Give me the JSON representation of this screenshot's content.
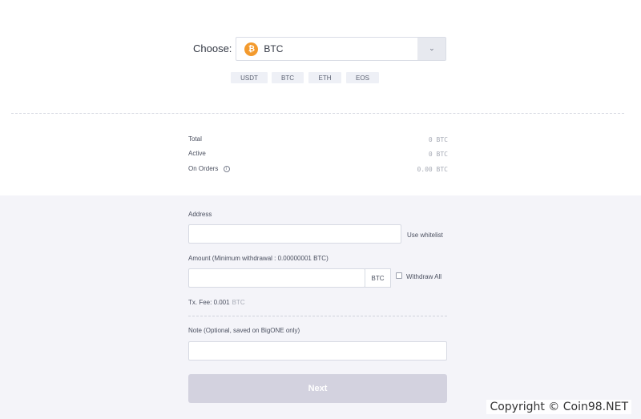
{
  "chooser": {
    "label": "Choose:",
    "selected": "BTC",
    "coin_icon_glyph": "₿",
    "arrow_glyph": "⌄"
  },
  "quick_coins": [
    "USDT",
    "BTC",
    "ETH",
    "EOS"
  ],
  "balance": {
    "total_label": "Total",
    "total_value": "0  BTC",
    "active_label": "Active",
    "active_value": "0  BTC",
    "orders_label": "On Orders",
    "orders_value": "0.00  BTC",
    "info_glyph": "i"
  },
  "form": {
    "address_label": "Address",
    "address_value": "",
    "use_whitelist": "Use whitelist",
    "amount_label": "Amount (Minimum withdrawal : 0.00000001 BTC)",
    "amount_value": "",
    "amount_unit": "BTC",
    "withdraw_all": "Withdraw All",
    "fee_label": "Tx. Fee: 0.001",
    "fee_unit": "BTC",
    "note_label": "Note (Optional, saved on BigONE only)",
    "note_value": "",
    "next_button": "Next"
  },
  "watermark": "Copyright © Coin98.NET",
  "colors": {
    "btc_orange": "#f39a2d",
    "form_bg": "#f4f4f9",
    "next_disabled": "#d3d2df"
  }
}
